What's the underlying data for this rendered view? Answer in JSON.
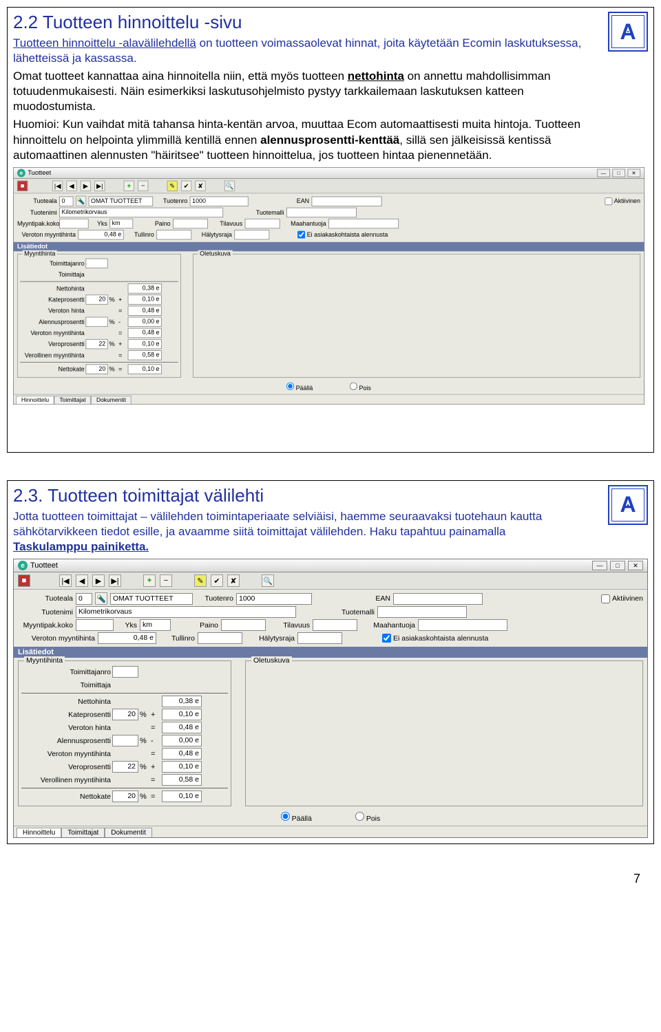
{
  "section1": {
    "title": "2.2 Tuotteen hinnoittelu -sivu",
    "intro_part1": "Tuotteen hinnoittelu -alavälilehdellä",
    "intro_part2": " on tuotteen voimassaolevat hinnat, joita käytetään Ecomin laskutuksessa, lähetteissä ja kassassa.",
    "para2_a": "Omat tuotteet kannattaa aina hinnoitella niin, että myös tuotteen ",
    "para2_net": "nettohinta",
    "para2_b": " on annettu mahdollisimman totuudenmukaisesti. Näin esimerkiksi laskutusohjelmisto pystyy tarkkailemaan laskutuksen katteen muodostumista.",
    "huomioi_label": "Huomioi: ",
    "huomioi_text": "Kun vaihdat mitä tahansa hinta-kentän arvoa, muuttaa Ecom automaattisesti muita hintoja. Tuotteen hinnoittelu on helpointa ylimmillä kentillä ennen ",
    "huomioi_bold": "alennusprosentti-kenttää",
    "huomioi_tail": ", sillä sen jälkeisissä kentissä automaattinen alennusten \"häiritsee\" tuotteen hinnoittelua, jos tuotteen hintaa pienennetään."
  },
  "section2": {
    "title": "2.3. Tuotteen toimittajat välilehti",
    "body_a": "Jotta tuotteen toimittajat – välilehden toimintaperiaate selviäisi, haemme seuraavaksi tuotehaun kautta sähkötarvikkeen tiedot esille, ja avaamme siitä toimittajat välilehden. Haku tapahtuu painamalla ",
    "body_b": "Taskulamppu painiketta."
  },
  "window": {
    "title": "Tuotteet",
    "form": {
      "tuoteala_lbl": "Tuoteala",
      "tuoteala_val": "0",
      "omattuotteet": "OMAT TUOTTEET",
      "tuotenro_lbl": "Tuotenro",
      "tuotenro_val": "1000",
      "ean_lbl": "EAN",
      "aktiivinen_lbl": "Aktiivinen",
      "tuotenimi_lbl": "Tuotenimi",
      "tuotenimi_val": "Kilometrikorvaus",
      "tuotemalli_lbl": "Tuotemalli",
      "myyntipak_lbl": "Myyntipak.koko",
      "yks_lbl": "Yks",
      "yks_val": "km",
      "paino_lbl": "Paino",
      "tilavuus_lbl": "Tilavuus",
      "maahantuoja_lbl": "Maahantuoja",
      "veroton_lbl": "Veroton myyntihinta",
      "veroton_val": "0,48 e",
      "tullinro_lbl": "Tullinro",
      "halytys_lbl": "Hälytysraja",
      "eiasiakas_lbl": "Ei asiakaskohtaista alennusta"
    },
    "lisatiedot_header": "Lisätiedot",
    "myyntihinta_legend": "Myyntihinta",
    "oletus_legend": "Oletuskuva",
    "prices": {
      "toimittajanro": "Toimittajanro",
      "toimittaja": "Toimittaja",
      "nettohinta": "Nettohinta",
      "nettohinta_v": "0,38 e",
      "kateprosentti": "Kateprosentti",
      "kate_p": "20",
      "kate_v": "0,10 e",
      "verotonhinta": "Veroton hinta",
      "verotonhinta_v": "0,48 e",
      "alennuspros": "Alennusprosentti",
      "alennus_v": "0,00 e",
      "verotonmyynti": "Veroton myyntihinta",
      "verotonmyynti_v": "0,48 e",
      "veropros": "Veroprosentti",
      "vero_p": "22",
      "vero_v": "0,10 e",
      "verollinen": "Verollinen myyntihinta",
      "verollinen_v": "0,58 e",
      "nettokate": "Nettokate",
      "nettokate_p": "20",
      "nettokate_v": "0,10 e"
    },
    "radio": {
      "paalla": "Päällä",
      "pois": "Pois"
    },
    "tabs": {
      "hinnoittelu": "Hinnoittelu",
      "toimittajat": "Toimittajat",
      "dokumentit": "Dokumentit"
    }
  },
  "logo_letter": "A",
  "pagenum": "7"
}
